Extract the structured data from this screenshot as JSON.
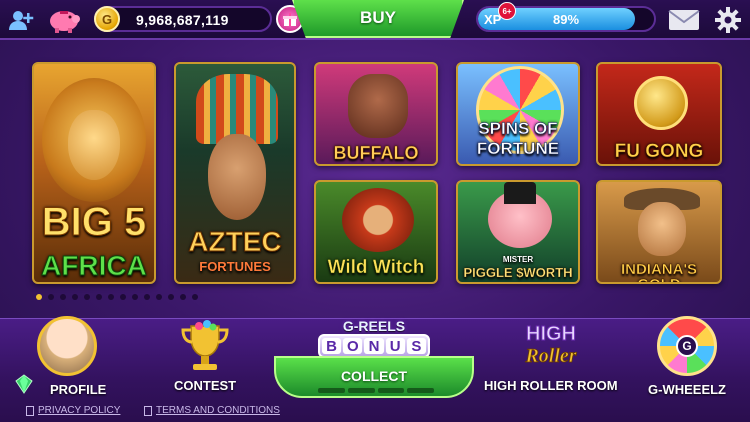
{
  "header": {
    "coin_balance": "9,968,687,119",
    "coin_symbol": "G",
    "buy_label": "BUY",
    "xp_label": "XP",
    "xp_level_badge": "6+",
    "xp_progress_fraction": 0.89,
    "xp_percent_label": "89%"
  },
  "games": [
    {
      "title_line1": "BIG 5",
      "title_line2": "AFRICA"
    },
    {
      "title_line1": "AZTEC",
      "title_line2": "FORTUNES"
    },
    {
      "title": "BUFFALO"
    },
    {
      "title_line1": "SPINS OF",
      "title_line2": "FORTUNE"
    },
    {
      "title": "FU GONG"
    },
    {
      "title": "Wild Witch"
    },
    {
      "title_line1": "MISTER",
      "title_line2": "PIGGLE $WORTH"
    },
    {
      "title": "INDIANA'S GOLD"
    }
  ],
  "pager": {
    "page_count": 14,
    "active_page": 1
  },
  "bottom_nav": {
    "profile_label": "PROFILE",
    "contest_label": "CONTEST",
    "greels_title": "G-REELS",
    "bonus_letters": [
      "B",
      "O",
      "N",
      "U",
      "S"
    ],
    "collect_label": "COLLECT",
    "high_roller_label": "HIGH ROLLER ROOM",
    "high_roller_logo_line1": "HIGH",
    "high_roller_logo_line2": "Roller",
    "gwheelz_label": "G-WHEEELZ",
    "gwheelz_hub": "G"
  },
  "footer": {
    "privacy_policy": "PRIVACY POLICY",
    "terms": "TERMS AND CONDITIONS"
  },
  "colors": {
    "accent_green": "#3cc23c",
    "gold": "#f2c232",
    "xp_blue": "#2aa6ff",
    "background_purple": "#3a1768"
  }
}
